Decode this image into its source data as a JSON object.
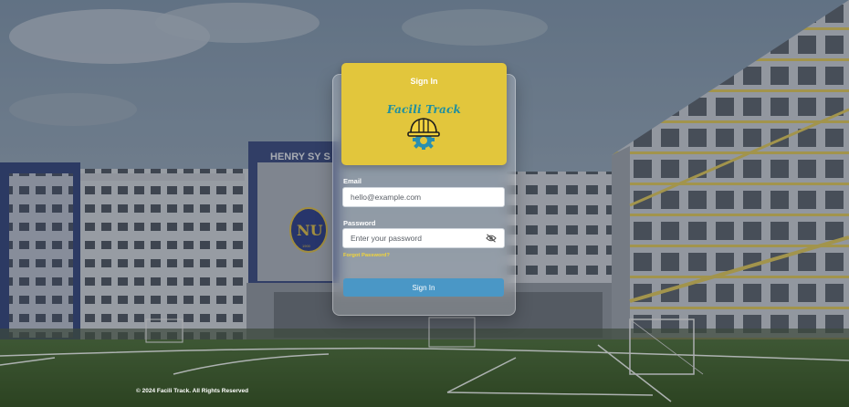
{
  "header": {
    "title": "Sign In",
    "brand": "Facili Track",
    "logo_icon": "hardhat-gear-icon",
    "brand_color": "#e2c63c"
  },
  "background": {
    "building_sign": "HENRY SY S",
    "crest_letters": "NU",
    "crest_year": "1900"
  },
  "form": {
    "email_label": "Email",
    "email_placeholder": "hello@example.com",
    "password_label": "Password",
    "password_placeholder": "Enter your password",
    "visibility_icon": "eye-off-icon",
    "forgot_label": "Forgot Password?",
    "submit_label": "Sign In",
    "button_color": "#4a97c6",
    "link_color": "#f2d53a"
  },
  "footer": {
    "copyright": "© 2024 Facili Track. All Rights Reserved"
  }
}
